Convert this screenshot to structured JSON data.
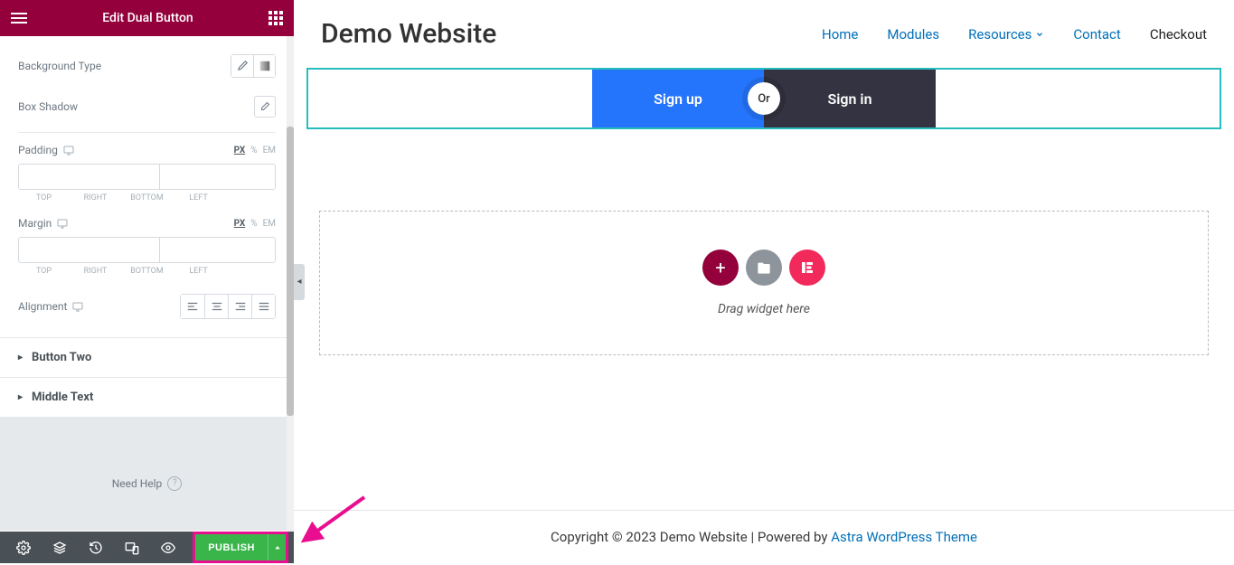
{
  "panel": {
    "title": "Edit Dual Button",
    "background_type": "Background Type",
    "box_shadow": "Box Shadow",
    "padding": {
      "label": "Padding",
      "units": [
        "PX",
        "%",
        "EM"
      ],
      "active_unit": "PX",
      "labels": [
        "TOP",
        "RIGHT",
        "BOTTOM",
        "LEFT"
      ]
    },
    "margin": {
      "label": "Margin",
      "units": [
        "PX",
        "%",
        "EM"
      ],
      "active_unit": "PX",
      "labels": [
        "TOP",
        "RIGHT",
        "BOTTOM",
        "LEFT"
      ]
    },
    "alignment": "Alignment",
    "accordions": [
      "Button Two",
      "Middle Text"
    ],
    "help": "Need Help",
    "publish": "PUBLISH"
  },
  "preview": {
    "site_title": "Demo Website",
    "nav": [
      {
        "label": "Home",
        "active": false
      },
      {
        "label": "Modules",
        "active": false
      },
      {
        "label": "Resources",
        "active": false,
        "dropdown": true
      },
      {
        "label": "Contact",
        "active": false
      },
      {
        "label": "Checkout",
        "active": true
      }
    ],
    "dual_button": {
      "left": "Sign up",
      "separator": "Or",
      "right": "Sign in"
    },
    "drop_text": "Drag widget here",
    "footer_text": "Copyright © 2023 Demo Website | Powered by ",
    "footer_link": "Astra WordPress Theme"
  }
}
